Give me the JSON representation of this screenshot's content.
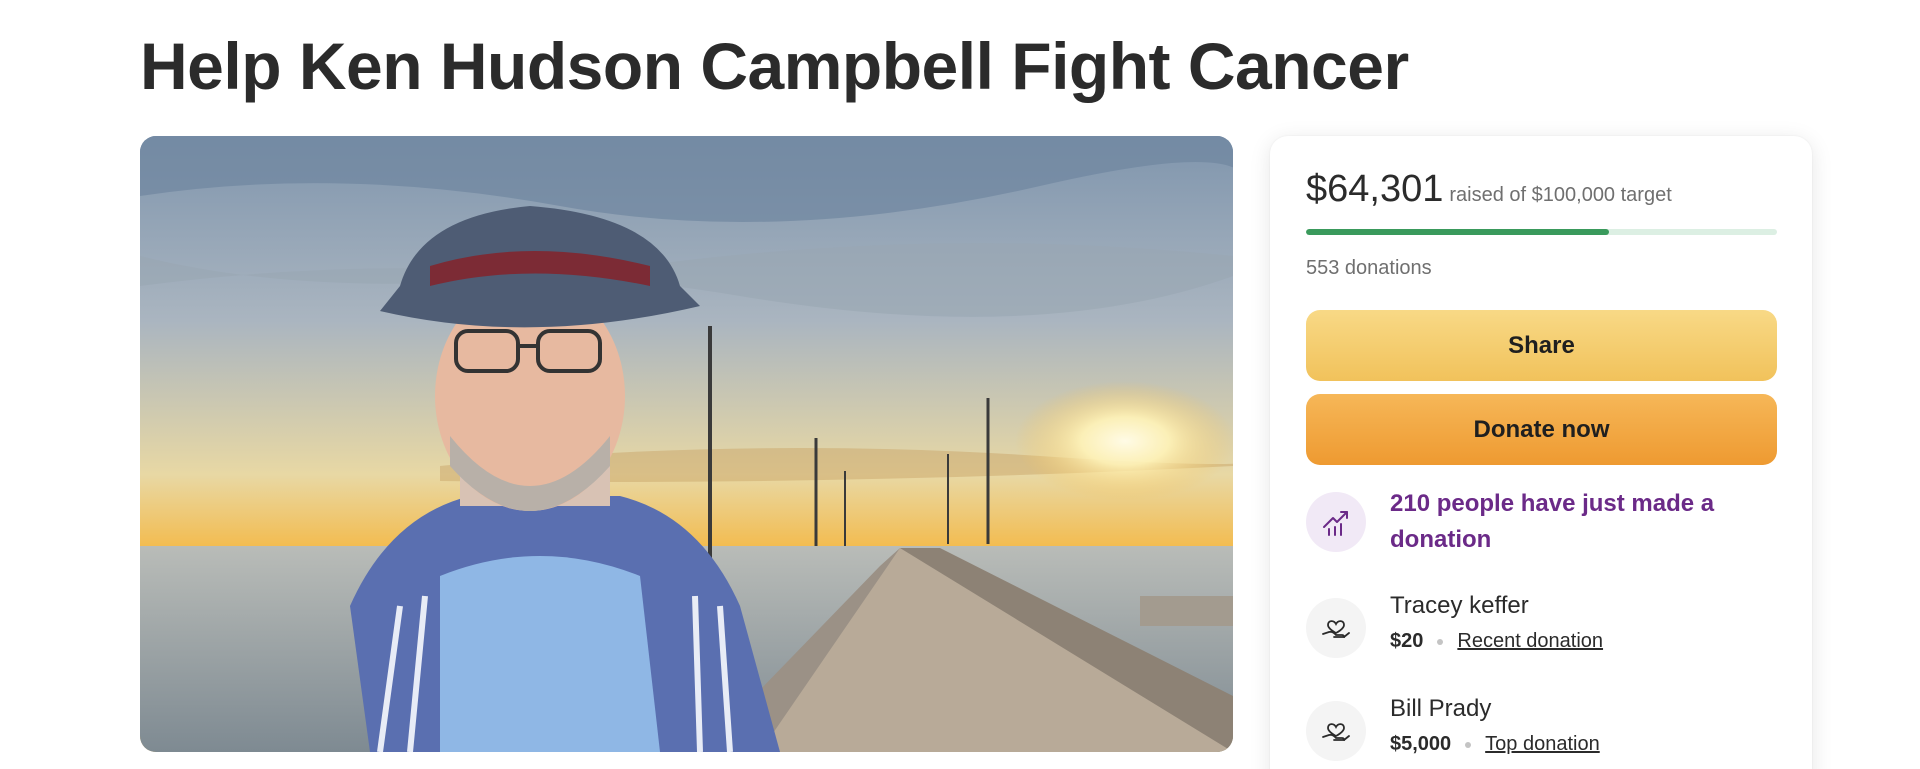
{
  "page": {
    "title": "Help Ken Hudson Campbell Fight Cancer"
  },
  "photo": {
    "description_icon": "campaign-photo"
  },
  "fundraiser": {
    "raised_amount": "$64,301",
    "raised_suffix": "raised of $100,000 target",
    "progress_fraction": 0.643,
    "donations_count": "553 donations",
    "share_label": "Share",
    "donate_label": "Donate now",
    "trend_text": "210 people have just made a donation",
    "trend_icon": "trend-up-icon",
    "donor_icon": "heart-hand-icon"
  },
  "donors": [
    {
      "name": "Tracey keffer",
      "amount": "$20",
      "tag": "Recent donation"
    },
    {
      "name": "Bill Prady",
      "amount": "$5,000",
      "tag": "Top donation"
    }
  ],
  "colors": {
    "progress_fill": "#3a9a5c",
    "progress_track": "#dcefe3",
    "share_button": "#f1c25b",
    "donate_button": "#ee9a31",
    "trend_text": "#6b2a88"
  }
}
